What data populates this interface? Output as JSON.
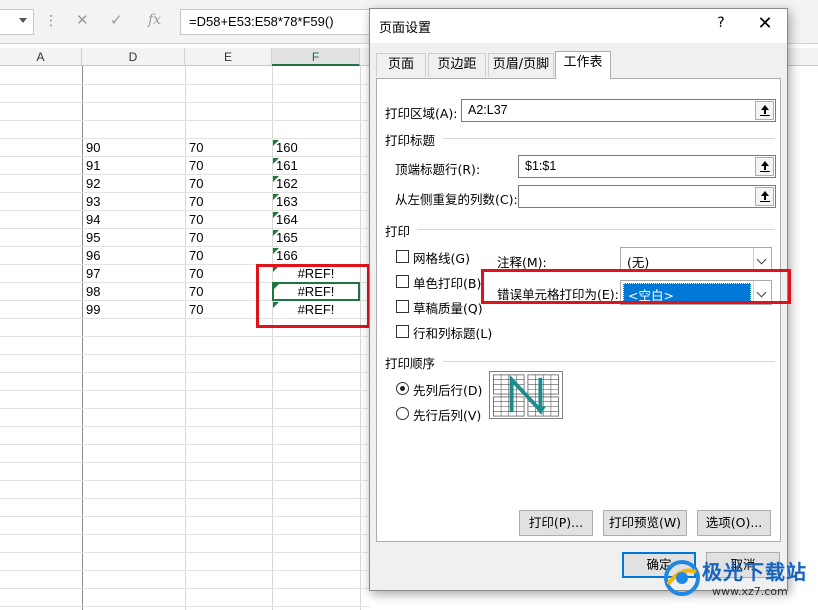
{
  "formula_bar": {
    "cancel_icon": "✕",
    "enter_icon": "✓",
    "fx_label": "fx",
    "formula": "=D58+E53:E58*78*F59()"
  },
  "columns": [
    "A",
    "D",
    "E",
    "F"
  ],
  "rows": [
    {
      "d": "90",
      "e": "70",
      "f": "160"
    },
    {
      "d": "91",
      "e": "70",
      "f": "161"
    },
    {
      "d": "92",
      "e": "70",
      "f": "162"
    },
    {
      "d": "93",
      "e": "70",
      "f": "163"
    },
    {
      "d": "94",
      "e": "70",
      "f": "164"
    },
    {
      "d": "95",
      "e": "70",
      "f": "165"
    },
    {
      "d": "96",
      "e": "70",
      "f": "166"
    },
    {
      "d": "97",
      "e": "70",
      "f": "#REF!"
    },
    {
      "d": "98",
      "e": "70",
      "f": "#REF!"
    },
    {
      "d": "99",
      "e": "70",
      "f": "#REF!"
    }
  ],
  "dialog": {
    "title": "页面设置",
    "help": "?",
    "close": "✕",
    "tabs": [
      "页面",
      "页边距",
      "页眉/页脚",
      "工作表"
    ],
    "active_tab": "工作表",
    "print_area_label": "打印区域(A):",
    "print_area_value": "A2:L37",
    "print_titles_group": "打印标题",
    "top_rows_label": "顶端标题行(R):",
    "top_rows_value": "$1:$1",
    "left_cols_label": "从左侧重复的列数(C):",
    "left_cols_value": "",
    "print_group": "打印",
    "gridlines_label": "网格线(G)",
    "mono_label": "单色打印(B)",
    "draft_label": "草稿质量(Q)",
    "headings_label": "行和列标题(L)",
    "comments_label": "注释(M):",
    "comments_value": "(无)",
    "errors_label": "错误单元格打印为(E):",
    "errors_value": "<空白>",
    "order_group": "打印顺序",
    "down_then_over_label": "先列后行(D)",
    "over_then_down_label": "先行后列(V)",
    "print_button": "打印(P)...",
    "preview_button": "打印预览(W)",
    "options_button": "选项(O)...",
    "ok_button": "确定",
    "cancel_button": "取消"
  },
  "watermark": {
    "brand": "极光下载站",
    "url": "www.xz7.com"
  },
  "colors": {
    "excel_green": "#217346",
    "highlight_red": "#e0131d",
    "selection_blue": "#0078d7"
  }
}
